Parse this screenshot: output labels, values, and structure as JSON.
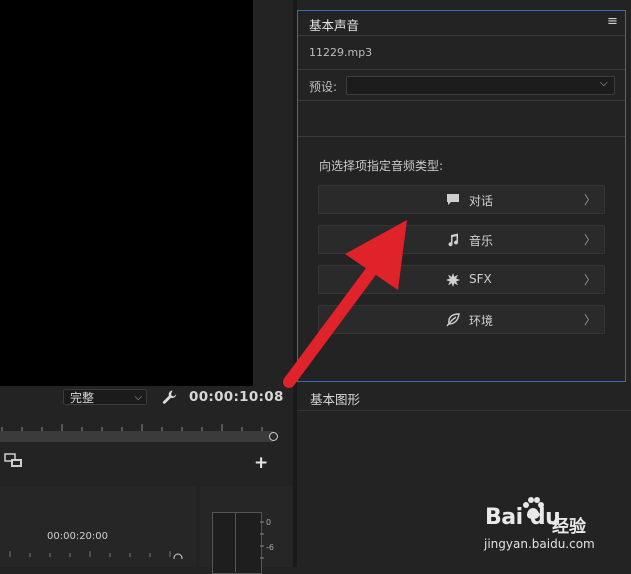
{
  "monitor": {
    "fit_value": "完整",
    "timecode": "00:00:10:08"
  },
  "timeline": {
    "ruler_time": "00:00:20:00"
  },
  "audio_meter": {
    "label_0": "0",
    "label_6": "-6"
  },
  "essential_sound": {
    "title": "基本声音",
    "menu_glyph": "≡",
    "file_name": "11229.mp3",
    "preset_label": "预设:",
    "preset_value": "",
    "prompt": "向选择项指定音频类型:",
    "types": [
      {
        "label": "对话",
        "icon": "speech-bubble-icon"
      },
      {
        "label": "音乐",
        "icon": "music-note-icon"
      },
      {
        "label": "SFX",
        "icon": "burst-icon"
      },
      {
        "label": "环境",
        "icon": "leaf-icon"
      }
    ]
  },
  "essential_graphics": {
    "title": "基本图形"
  },
  "watermark": {
    "logo": "Bai du",
    "cn": "经验",
    "url": "jingyan.baidu.com"
  },
  "colors": {
    "panel_focus_border": "#2f6db5",
    "arrow": "#e0222a"
  }
}
